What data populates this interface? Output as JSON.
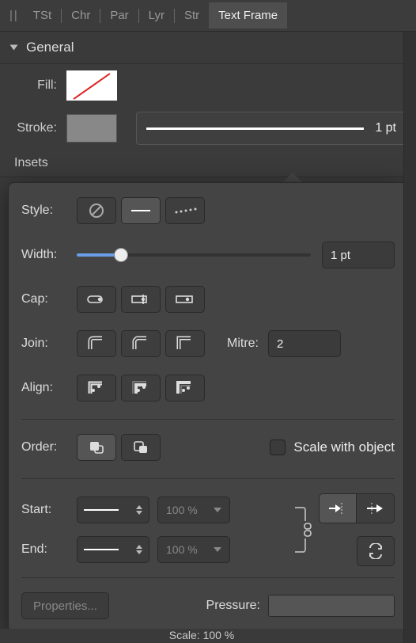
{
  "tabs": {
    "t0": "TSt",
    "t1": "Chr",
    "t2": "Par",
    "t3": "Lyr",
    "t4": "Str",
    "active": "Text Frame"
  },
  "section": {
    "general": "General",
    "fill_label": "Fill:",
    "stroke_label": "Stroke:",
    "stroke_width": "1 pt",
    "insets_label": "Insets"
  },
  "popover": {
    "style": "Style:",
    "width": "Width:",
    "width_val": "1 pt",
    "cap": "Cap:",
    "join": "Join:",
    "mitre": "Mitre:",
    "mitre_val": "2",
    "align": "Align:",
    "order": "Order:",
    "scale_obj": "Scale with object",
    "start": "Start:",
    "end": "End:",
    "start_pct": "100 %",
    "end_pct": "100 %",
    "properties": "Properties...",
    "pressure": "Pressure:"
  },
  "footer": {
    "scale_hint": "Scale:   100 %"
  }
}
